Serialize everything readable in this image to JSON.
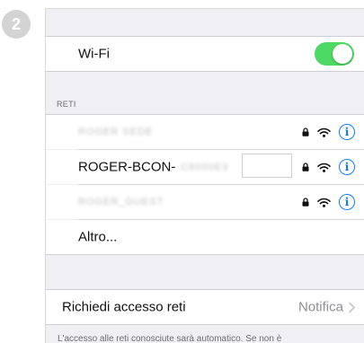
{
  "step_badge": "2",
  "wifi": {
    "label": "Wi-Fi",
    "enabled": true
  },
  "networks": {
    "header": "RETI",
    "items": [
      {
        "label": "ROGER SEDE",
        "obscured": true
      },
      {
        "label": "ROGER-BCON-",
        "suffix": "C8000E3",
        "obscured_suffix": true
      },
      {
        "label": "ROGER_GUEST",
        "obscured": true
      }
    ],
    "other_label": "Altro..."
  },
  "access": {
    "label": "Richiedi accesso reti",
    "value": "Notifica"
  },
  "footer": "L'accesso alle reti conosciute sarà automatico. Se non è",
  "colors": {
    "toggle_on": "#4cd964",
    "accent": "#0a7cff",
    "background": "#efeff4"
  }
}
